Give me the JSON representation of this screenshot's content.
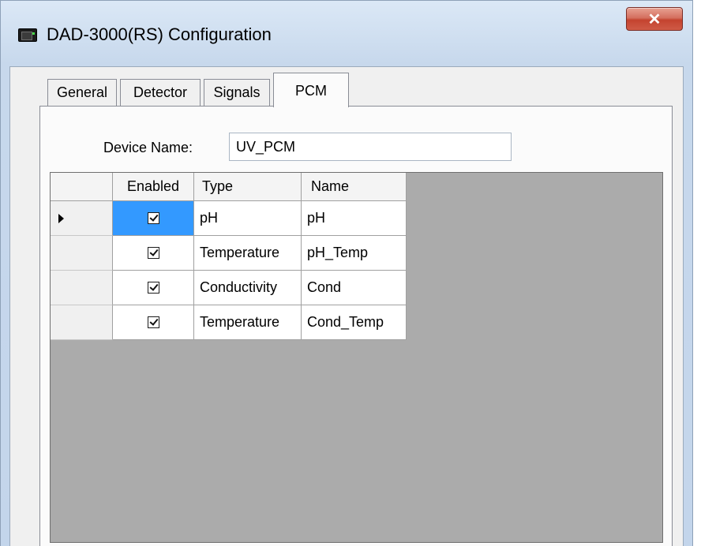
{
  "window": {
    "title": "DAD-3000(RS) Configuration",
    "close_glyph": "✕",
    "icon": "device-icon"
  },
  "tabs": [
    {
      "label": "General"
    },
    {
      "label": "Detector"
    },
    {
      "label": "Signals"
    },
    {
      "label": "PCM",
      "selected": true
    }
  ],
  "device": {
    "label": "Device Name:",
    "value": "UV_PCM"
  },
  "grid": {
    "columns": [
      "Enabled",
      "Type",
      "Name"
    ],
    "selected_row": 0,
    "rows": [
      {
        "enabled": true,
        "type": "pH",
        "name": "pH"
      },
      {
        "enabled": true,
        "type": "Temperature",
        "name": "pH_Temp"
      },
      {
        "enabled": true,
        "type": "Conductivity",
        "name": "Cond"
      },
      {
        "enabled": true,
        "type": "Temperature",
        "name": "Cond_Temp"
      }
    ]
  },
  "colors": {
    "selection": "#3399ff",
    "grid_background": "#ababab",
    "close_button": "#c4432f"
  }
}
